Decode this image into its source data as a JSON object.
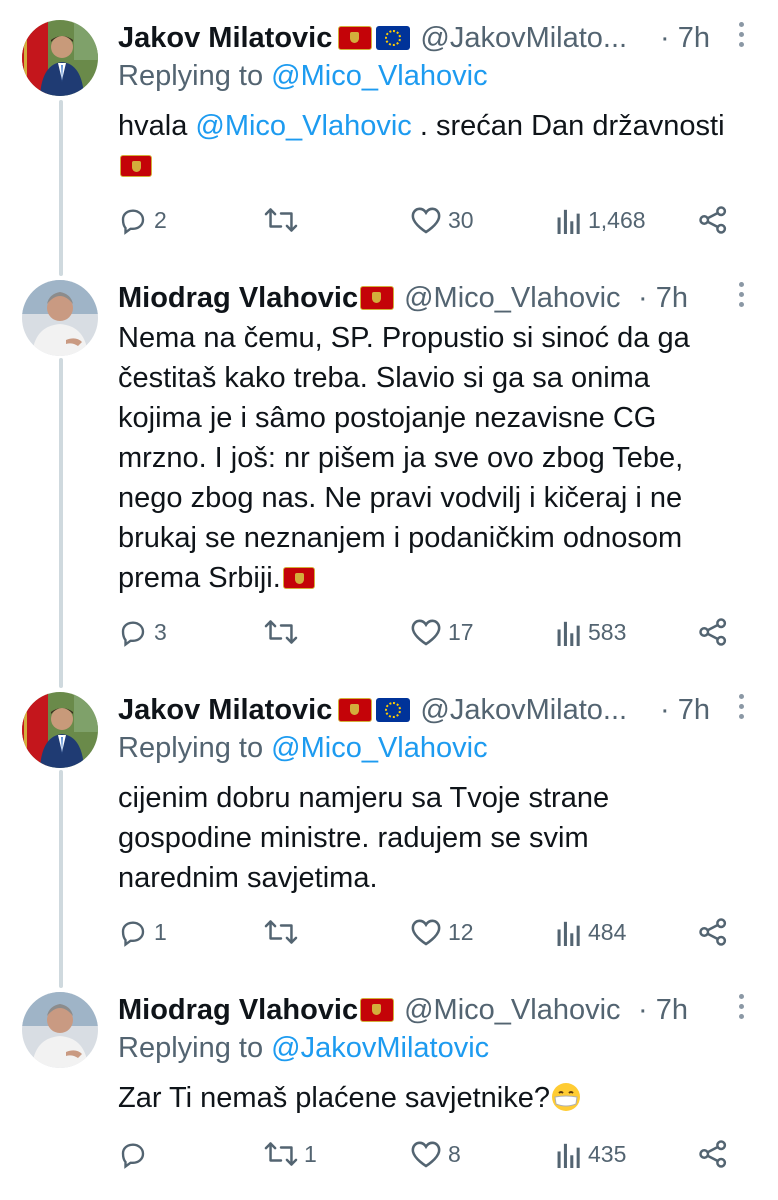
{
  "tweets": [
    {
      "name": "Jakov Milatovic",
      "flags": [
        "montenegro-flag",
        "eu-flag"
      ],
      "handle": "@JakovMilato...",
      "time": "· 7h",
      "reply_prefix": "Replying to ",
      "reply_to": "@Mico_Vlahovic",
      "text_prefix": "hvala ",
      "mention": "@Mico_Vlahovic",
      "text_suffix": " . srećan Dan državnosti",
      "trailing_emoji": "montenegro-flag",
      "replies": "2",
      "retweets": "",
      "likes": "30",
      "views": "1,468"
    },
    {
      "name": "Miodrag Vlahovic",
      "flags": [
        "montenegro-flag"
      ],
      "handle": "@Mico_Vlahovic",
      "time": "· 7h",
      "text": "Nema na čemu, SP. Propustio si sinoć da ga čestitaš kako treba. Slavio si ga sa onima kojima je i sâmo postojanje nezavisne CG mrzno. I još: nr pišem ja sve ovo zbog Tebe, nego zbog nas. Ne pravi vodvilj i kičeraj i ne brukaj se neznanjem i podaničkim odnosom prema Srbiji.",
      "trailing_emoji": "montenegro-flag",
      "replies": "3",
      "retweets": "",
      "likes": "17",
      "views": "583"
    },
    {
      "name": "Jakov Milatovic",
      "flags": [
        "montenegro-flag",
        "eu-flag"
      ],
      "handle": "@JakovMilato...",
      "time": "· 7h",
      "reply_prefix": "Replying to ",
      "reply_to": "@Mico_Vlahovic",
      "text": "cijenim dobru namjeru sa Tvoje strane gospodine ministre. radujem se svim narednim savjetima.",
      "replies": "1",
      "retweets": "",
      "likes": "12",
      "views": "484"
    },
    {
      "name": "Miodrag Vlahovic",
      "flags": [
        "montenegro-flag"
      ],
      "handle": "@Mico_Vlahovic",
      "time": "· 7h",
      "reply_prefix": "Replying to ",
      "reply_to": "@JakovMilatovic",
      "text": "Zar Ti nemaš plaćene savjetnike?",
      "trailing_emoji": "mask-face-emoji",
      "replies": "",
      "retweets": "1",
      "likes": "8",
      "views": "435"
    }
  ],
  "colors": {
    "link": "#1d9bf0",
    "secondary": "#536471",
    "primary_text": "#0f1419",
    "thread_line": "#cfd9de"
  }
}
